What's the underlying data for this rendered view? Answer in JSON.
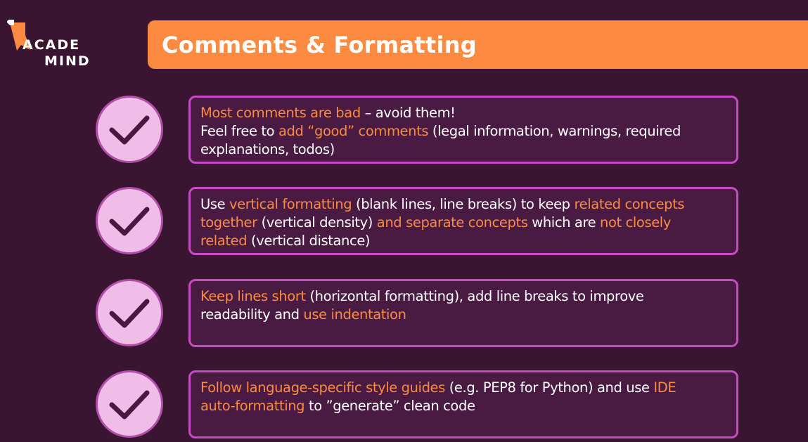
{
  "logo": {
    "line1": "ACADE",
    "line2": "MIND"
  },
  "title": "Comments & Formatting",
  "colors": {
    "background": "#3a1532",
    "accent": "#fd8a41",
    "card_border": "#c94bc3",
    "check_fill": "#f0bce8"
  },
  "items": [
    {
      "icon": "checkmark-icon",
      "lines": [
        [
          {
            "text": "Most comments are bad",
            "hl": true
          },
          {
            "text": " – avoid them!",
            "hl": false
          }
        ],
        [
          {
            "text": "Feel free to ",
            "hl": false
          },
          {
            "text": "add “good” comments",
            "hl": true
          },
          {
            "text": " (legal information, warnings, required",
            "hl": false
          }
        ],
        [
          {
            "text": "explanations, todos)",
            "hl": false
          }
        ]
      ]
    },
    {
      "icon": "checkmark-icon",
      "lines": [
        [
          {
            "text": "Use ",
            "hl": false
          },
          {
            "text": "vertical formatting",
            "hl": true
          },
          {
            "text": " (blank lines, line breaks) to keep ",
            "hl": false
          },
          {
            "text": "related concepts",
            "hl": true
          }
        ],
        [
          {
            "text": "together",
            "hl": true
          },
          {
            "text": " (vertical density) ",
            "hl": false
          },
          {
            "text": "and separate concepts",
            "hl": true
          },
          {
            "text": " which are ",
            "hl": false
          },
          {
            "text": "not closely",
            "hl": true
          }
        ],
        [
          {
            "text": "related",
            "hl": true
          },
          {
            "text": " (vertical distance)",
            "hl": false
          }
        ]
      ]
    },
    {
      "icon": "checkmark-icon",
      "lines": [
        [
          {
            "text": "Keep lines short",
            "hl": true
          },
          {
            "text": " (horizontal formatting), add line breaks to improve",
            "hl": false
          }
        ],
        [
          {
            "text": "readability and ",
            "hl": false
          },
          {
            "text": "use indentation",
            "hl": true
          }
        ]
      ]
    },
    {
      "icon": "checkmark-icon",
      "lines": [
        [
          {
            "text": "Follow language-specific style guides",
            "hl": true
          },
          {
            "text": " (e.g. PEP8 for Python) and use ",
            "hl": false
          },
          {
            "text": "IDE",
            "hl": true
          }
        ],
        [
          {
            "text": "auto-formatting",
            "hl": true
          },
          {
            "text": " to ”generate” clean code",
            "hl": false
          }
        ]
      ]
    }
  ]
}
